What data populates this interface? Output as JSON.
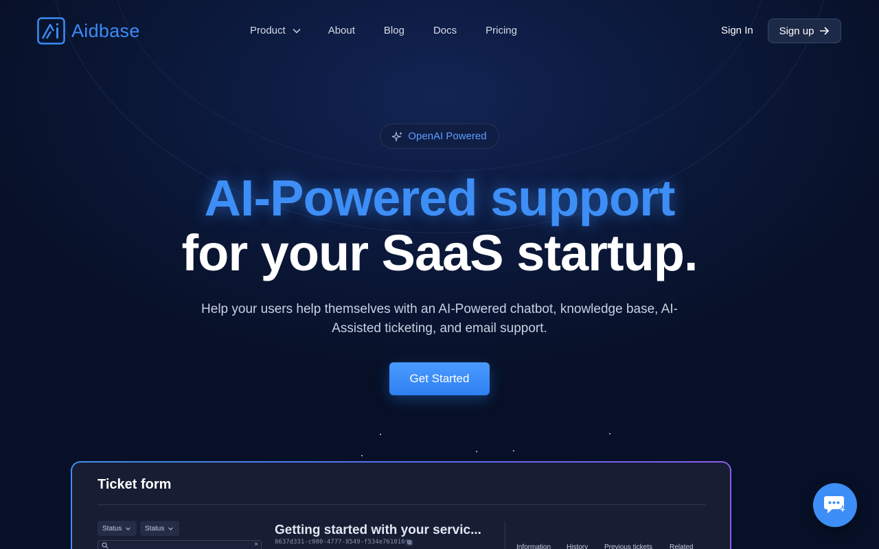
{
  "brand": {
    "name": "Aidbase",
    "color": "#3b8cf7",
    "logo_icon": "aidbase-logo-icon"
  },
  "nav": {
    "items": [
      {
        "label": "Product",
        "icon": "chevron-down-icon"
      },
      {
        "label": "About"
      },
      {
        "label": "Blog"
      },
      {
        "label": "Docs"
      },
      {
        "label": "Pricing"
      }
    ],
    "sign_in": "Sign In",
    "sign_up": "Sign up",
    "sign_up_icon": "arrow-right-icon"
  },
  "hero": {
    "badge": "OpenAI Powered",
    "badge_icon": "sparkle-icon",
    "headline_1": "AI-Powered support",
    "headline_2": "for your SaaS startup.",
    "subtitle": "Help your users help themselves with an AI-Powered chatbot, knowledge base, AI-Assisted ticketing, and email support.",
    "cta": "Get Started"
  },
  "preview": {
    "title": "Ticket form",
    "filters": [
      "Status",
      "Status"
    ],
    "search_icon": "search-icon",
    "clear_label": "×",
    "ticket_title": "Getting started with your servic...",
    "ticket_id": "8637d331-c080-4777-8549-f534e7610166",
    "tabs": [
      "Information",
      "History",
      "Previous tickets",
      "Related"
    ]
  },
  "chat_widget": {
    "icon": "chat-bubble-icon"
  },
  "colors": {
    "background": "#071026",
    "accent": "#3d8ef6",
    "panel_border_start": "#3f8ff5",
    "panel_border_end": "#8a5cf0"
  }
}
